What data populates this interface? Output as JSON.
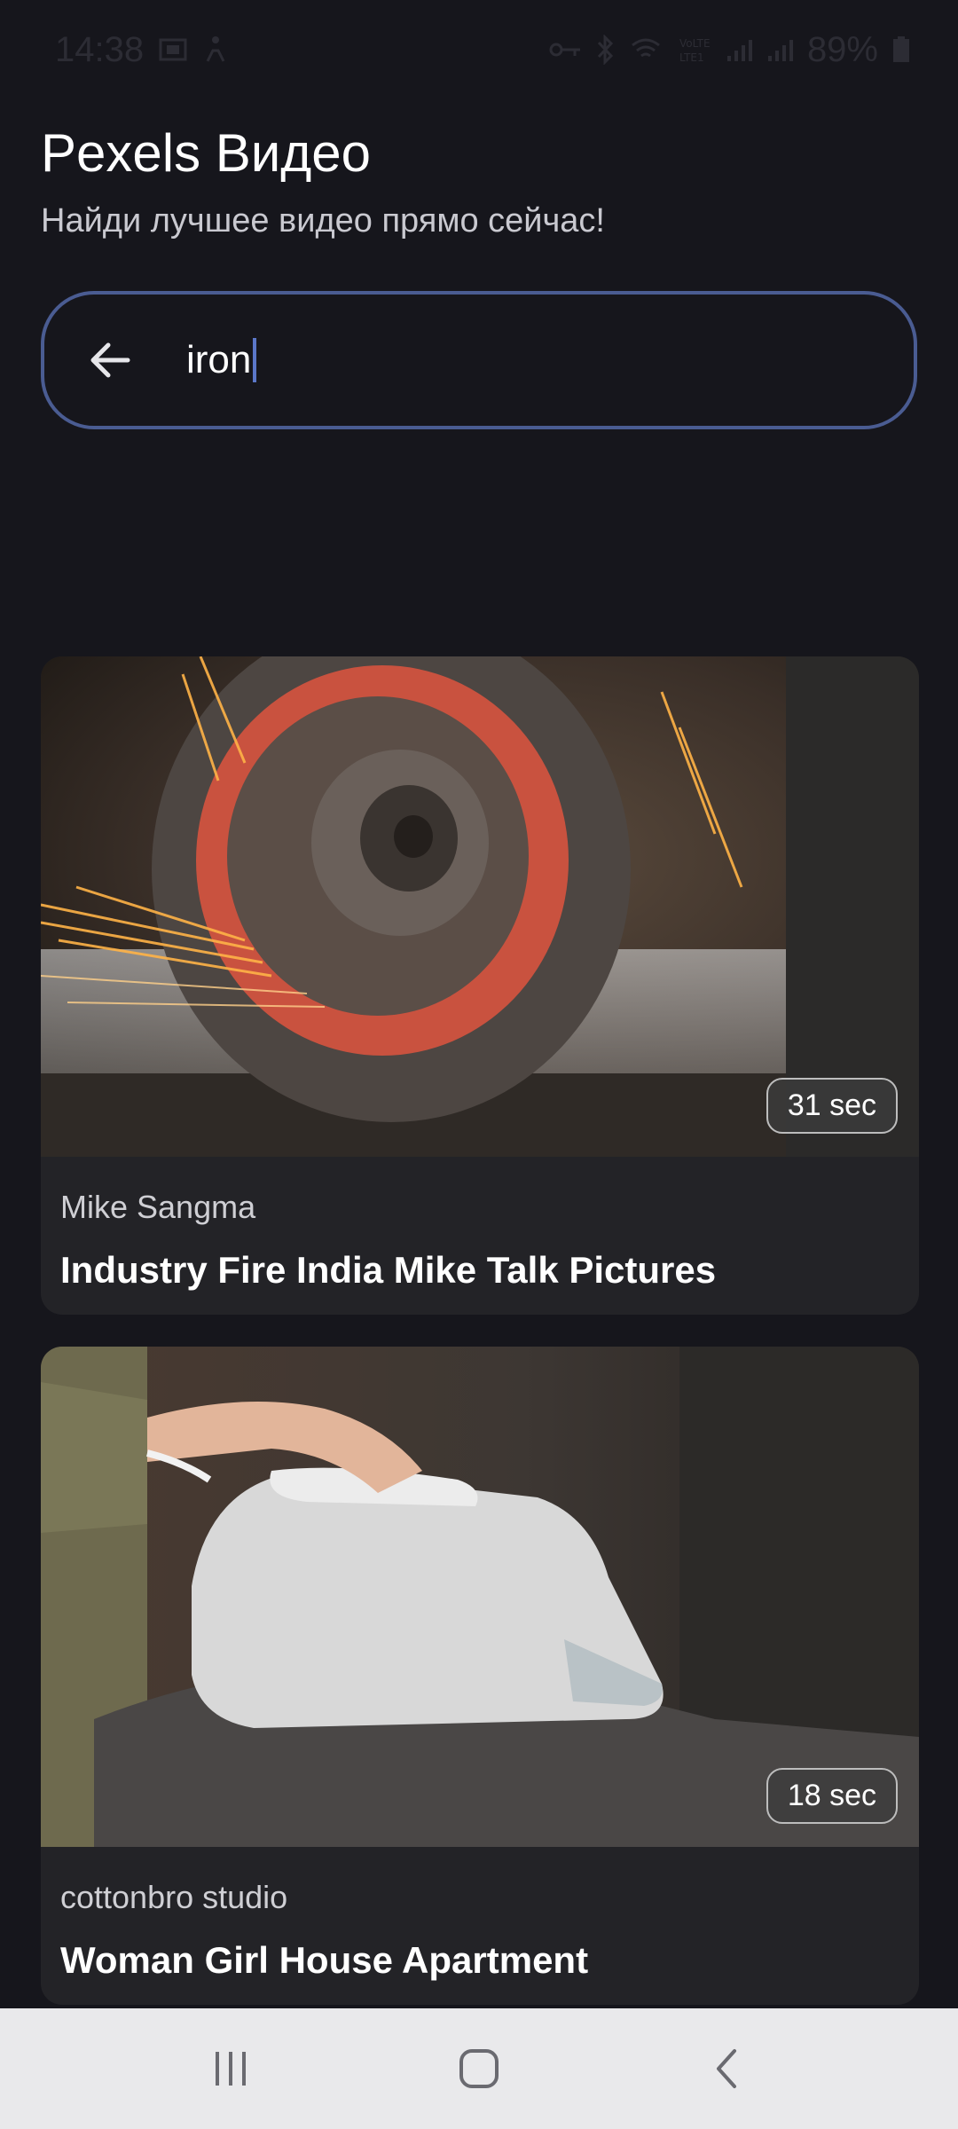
{
  "status": {
    "time": "14:38",
    "battery": "89%"
  },
  "header": {
    "title": "Pexels Видео",
    "subtitle": "Найди лучшее видео прямо сейчас!"
  },
  "search": {
    "value": "iron"
  },
  "videos": [
    {
      "author": "Mike Sangma",
      "title": "Industry Fire India Mike Talk Pictures",
      "duration": "31 sec"
    },
    {
      "author": "cottonbro studio",
      "title": "Woman Girl House Apartment",
      "duration": "18 sec"
    }
  ],
  "icons": {
    "back": "arrow-left-icon",
    "recents": "recents-icon",
    "home": "home-icon",
    "nav_back": "chevron-left-icon"
  },
  "colors": {
    "background": "#16161c",
    "card": "#232327",
    "search_border": "#4a5c92",
    "caret": "#5b77c9",
    "nav_bar": "#e9e9eb"
  }
}
